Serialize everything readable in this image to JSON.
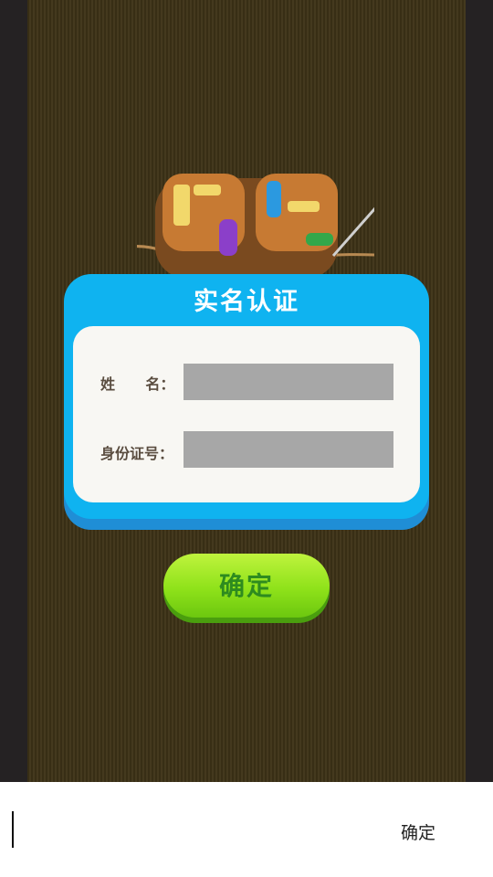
{
  "dialog": {
    "title": "实名认证",
    "name_label": "姓      名：",
    "id_label": "身份证号：",
    "name_value": "",
    "id_value": ""
  },
  "confirm_button": {
    "label": "确定"
  },
  "input_bar": {
    "confirm_label": "确定"
  },
  "colors": {
    "dialog_blue": "#0fb3f0",
    "confirm_green": "#8fe21a",
    "panel": "#f8f7f3"
  }
}
